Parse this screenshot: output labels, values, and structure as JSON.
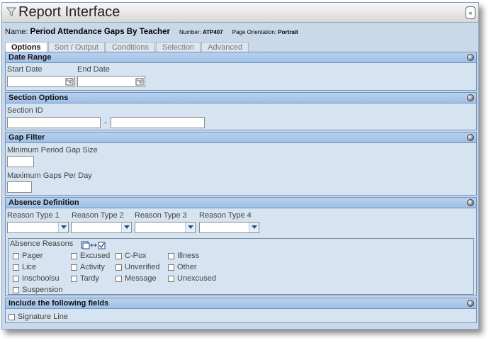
{
  "window": {
    "title": "Report Interface",
    "collapse_label": "«"
  },
  "report": {
    "name_label": "Name:",
    "name": "Period Attendance Gaps By Teacher",
    "number_label": "Number:",
    "number": "ATP407",
    "orientation_label": "Page Orientation:",
    "orientation": "Portrait"
  },
  "tabs": [
    {
      "label": "Options",
      "active": true
    },
    {
      "label": "Sort / Output"
    },
    {
      "label": "Conditions"
    },
    {
      "label": "Selection"
    },
    {
      "label": "Advanced"
    }
  ],
  "date_range": {
    "header": "Date Range",
    "start_label": "Start Date",
    "end_label": "End Date",
    "start_value": "",
    "end_value": ""
  },
  "section_options": {
    "header": "Section Options",
    "section_id_label": "Section ID",
    "dash": "-",
    "from_value": "",
    "to_value": ""
  },
  "gap_filter": {
    "header": "Gap Filter",
    "min_label": "Minimum Period Gap Size",
    "max_label": "Maximum Gaps Per Day",
    "min_value": "",
    "max_value": ""
  },
  "absence_definition": {
    "header": "Absence Definition",
    "reason_types": [
      "Reason Type 1",
      "Reason Type 2",
      "Reason Type 3",
      "Reason Type 4"
    ],
    "reasons_label": "Absence Reasons",
    "reasons": [
      [
        "Pager",
        "Excused",
        "C-Pox",
        "Illness"
      ],
      [
        "Lice",
        "Activity",
        "Unverified",
        "Other"
      ],
      [
        "Inschoolsu",
        "Tardy",
        "Message",
        "Unexcused"
      ],
      [
        "Suspension"
      ]
    ]
  },
  "include_fields": {
    "header": "Include the following fields",
    "signature_line": "Signature Line"
  },
  "icons": {
    "funnel": "funnel-icon",
    "calendar": "calendar-icon",
    "toggle": "select-toggle-icon",
    "collapse": "circle-toggle-icon"
  }
}
